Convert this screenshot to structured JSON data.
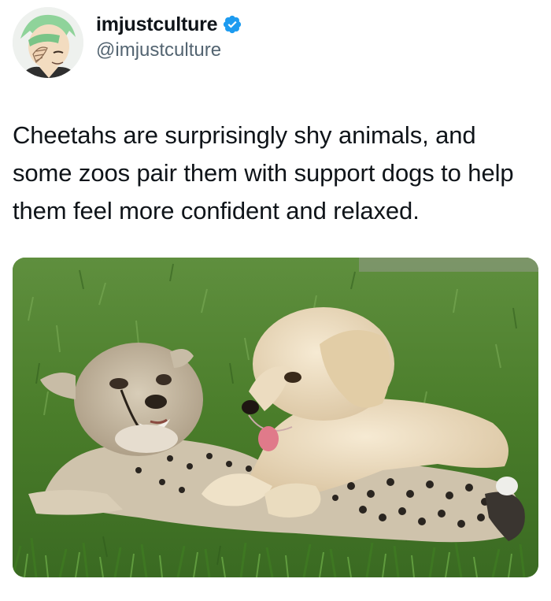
{
  "tweet": {
    "author": {
      "display_name": "imjustculture",
      "handle": "@imjustculture",
      "verified": true,
      "verified_icon": "verified-badge-icon",
      "avatar_description": "avatar"
    },
    "text": "Cheetahs are surprisingly shy animals, and some zoos pair them with support dogs to help them feel more confident and relaxed.",
    "media": {
      "type": "photo"
    }
  },
  "colors": {
    "text_primary": "#0f1419",
    "text_secondary": "#536471",
    "verified_blue": "#1d9bf0"
  }
}
